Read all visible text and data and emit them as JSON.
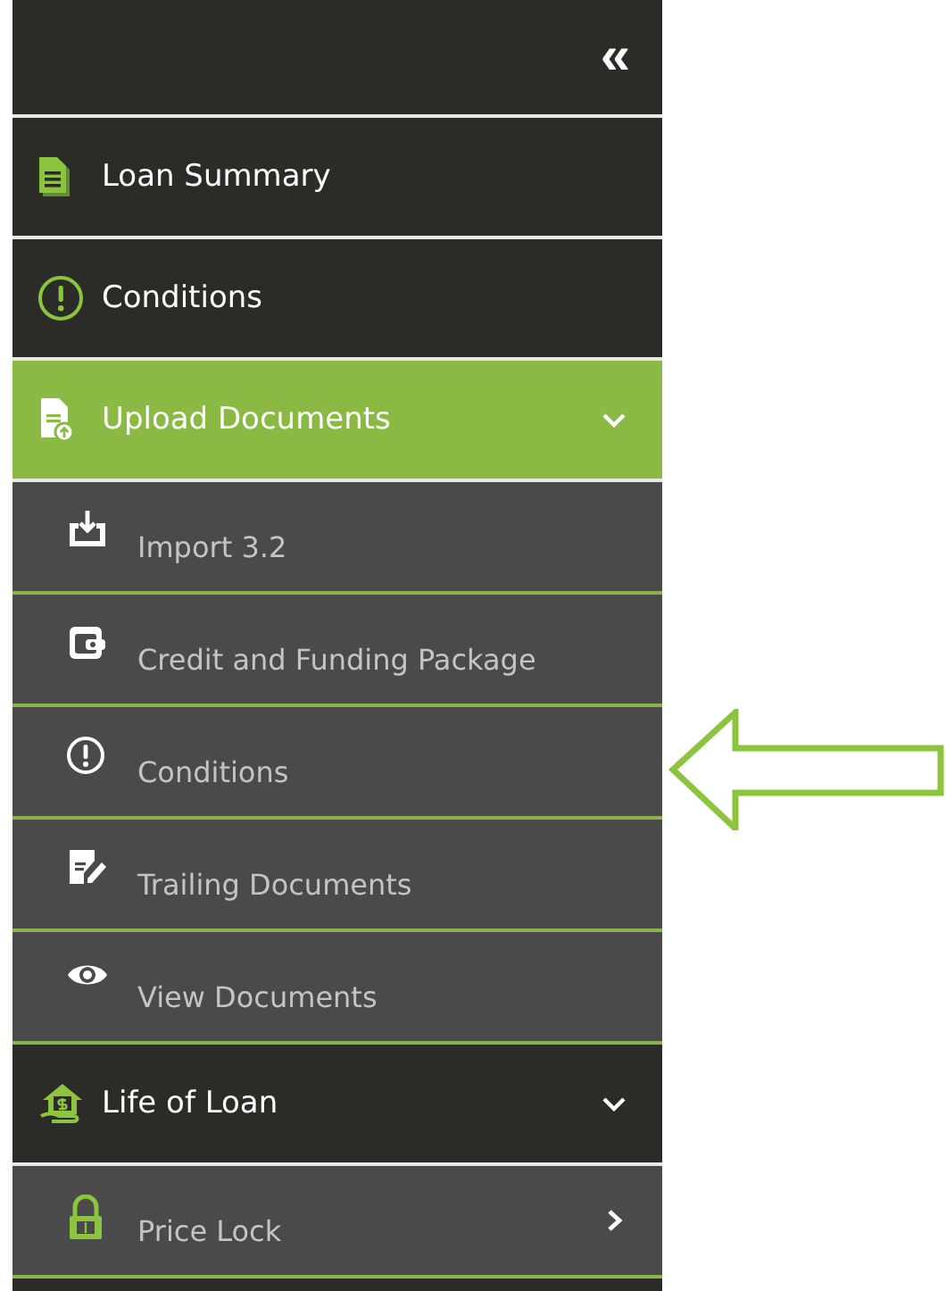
{
  "sidebar": {
    "collapse_label": "«",
    "items": [
      {
        "kind": "top",
        "label": "Loan Summary",
        "selected": false
      },
      {
        "kind": "top",
        "label": "Conditions",
        "selected": false
      },
      {
        "kind": "top",
        "label": "Upload Documents",
        "selected": true,
        "expanded": true
      },
      {
        "kind": "sub",
        "label": "Import 3.2",
        "selected": false
      },
      {
        "kind": "sub",
        "label": "Credit and Funding Package",
        "selected": false
      },
      {
        "kind": "sub",
        "label": "Conditions",
        "selected": false
      },
      {
        "kind": "sub",
        "label": "Trailing Documents",
        "selected": false
      },
      {
        "kind": "sub",
        "label": "View Documents",
        "selected": false
      },
      {
        "kind": "top",
        "label": "Life of Loan",
        "selected": false,
        "expanded": true
      },
      {
        "kind": "sub",
        "label": "Price Lock",
        "selected": false,
        "expanded": false
      }
    ]
  }
}
